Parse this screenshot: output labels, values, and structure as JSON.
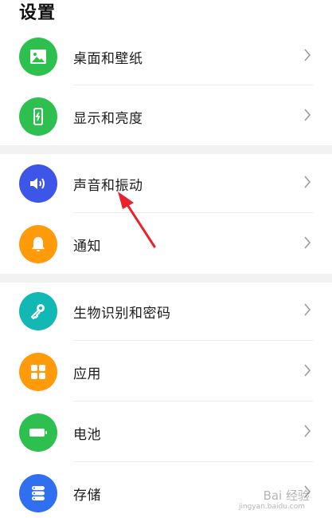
{
  "header": {
    "title": "设置"
  },
  "settings": {
    "items": [
      {
        "label": "桌面和壁纸",
        "icon": "wallpaper-icon",
        "color": "#2ec04f"
      },
      {
        "label": "显示和亮度",
        "icon": "display-brightness-icon",
        "color": "#2ec04f"
      },
      {
        "label": "声音和振动",
        "icon": "sound-icon",
        "color": "#3d56e8"
      },
      {
        "label": "通知",
        "icon": "notification-bell-icon",
        "color": "#ff9a0a"
      },
      {
        "label": "生物识别和密码",
        "icon": "key-icon",
        "color": "#12b8b4"
      },
      {
        "label": "应用",
        "icon": "apps-grid-icon",
        "color": "#ff9a0a"
      },
      {
        "label": "电池",
        "icon": "battery-icon",
        "color": "#2ec04f"
      },
      {
        "label": "存储",
        "icon": "storage-icon",
        "color": "#2f6ff0"
      }
    ]
  },
  "annotation": {
    "arrow_color": "#e8232d"
  },
  "watermark": {
    "text": "Bai 经验",
    "subtext": "jingyan.baidu.com"
  }
}
